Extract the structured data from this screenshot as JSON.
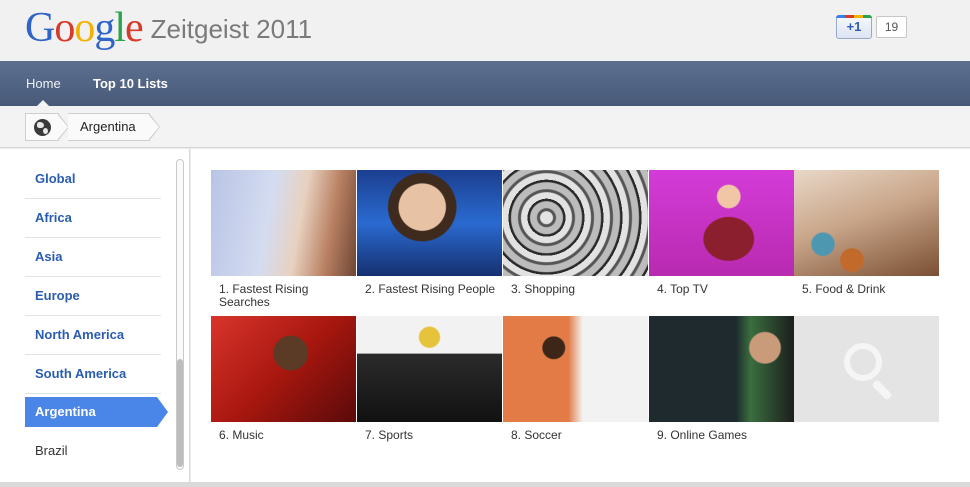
{
  "header": {
    "logo_letters": [
      "G",
      "o",
      "o",
      "g",
      "l",
      "e"
    ],
    "title": "Zeitgeist 2011",
    "plusone_label": "+1",
    "plusone_count": "19"
  },
  "nav": {
    "home": "Home",
    "top_lists": "Top 10 Lists"
  },
  "breadcrumb": {
    "current": "Argentina",
    "icon": "globe-icon"
  },
  "sidebar": {
    "items": [
      {
        "label": "Global"
      },
      {
        "label": "Africa"
      },
      {
        "label": "Asia"
      },
      {
        "label": "Europe"
      },
      {
        "label": "North America"
      },
      {
        "label": "South America"
      },
      {
        "label": "Argentina"
      },
      {
        "label": "Brazil"
      }
    ],
    "active": "Argentina"
  },
  "categories": [
    {
      "caption": "1. Fastest Rising Searches"
    },
    {
      "caption": "2. Fastest Rising People"
    },
    {
      "caption": "3. Shopping"
    },
    {
      "caption": "4. Top TV"
    },
    {
      "caption": "5. Food & Drink"
    },
    {
      "caption": "6. Music"
    },
    {
      "caption": "7. Sports"
    },
    {
      "caption": "8. Soccer"
    },
    {
      "caption": "9. Online Games"
    },
    {
      "caption": ""
    }
  ],
  "colors": {
    "nav_bg": "#53668a",
    "active_item": "#4a86e8",
    "link": "#2a5db0"
  }
}
